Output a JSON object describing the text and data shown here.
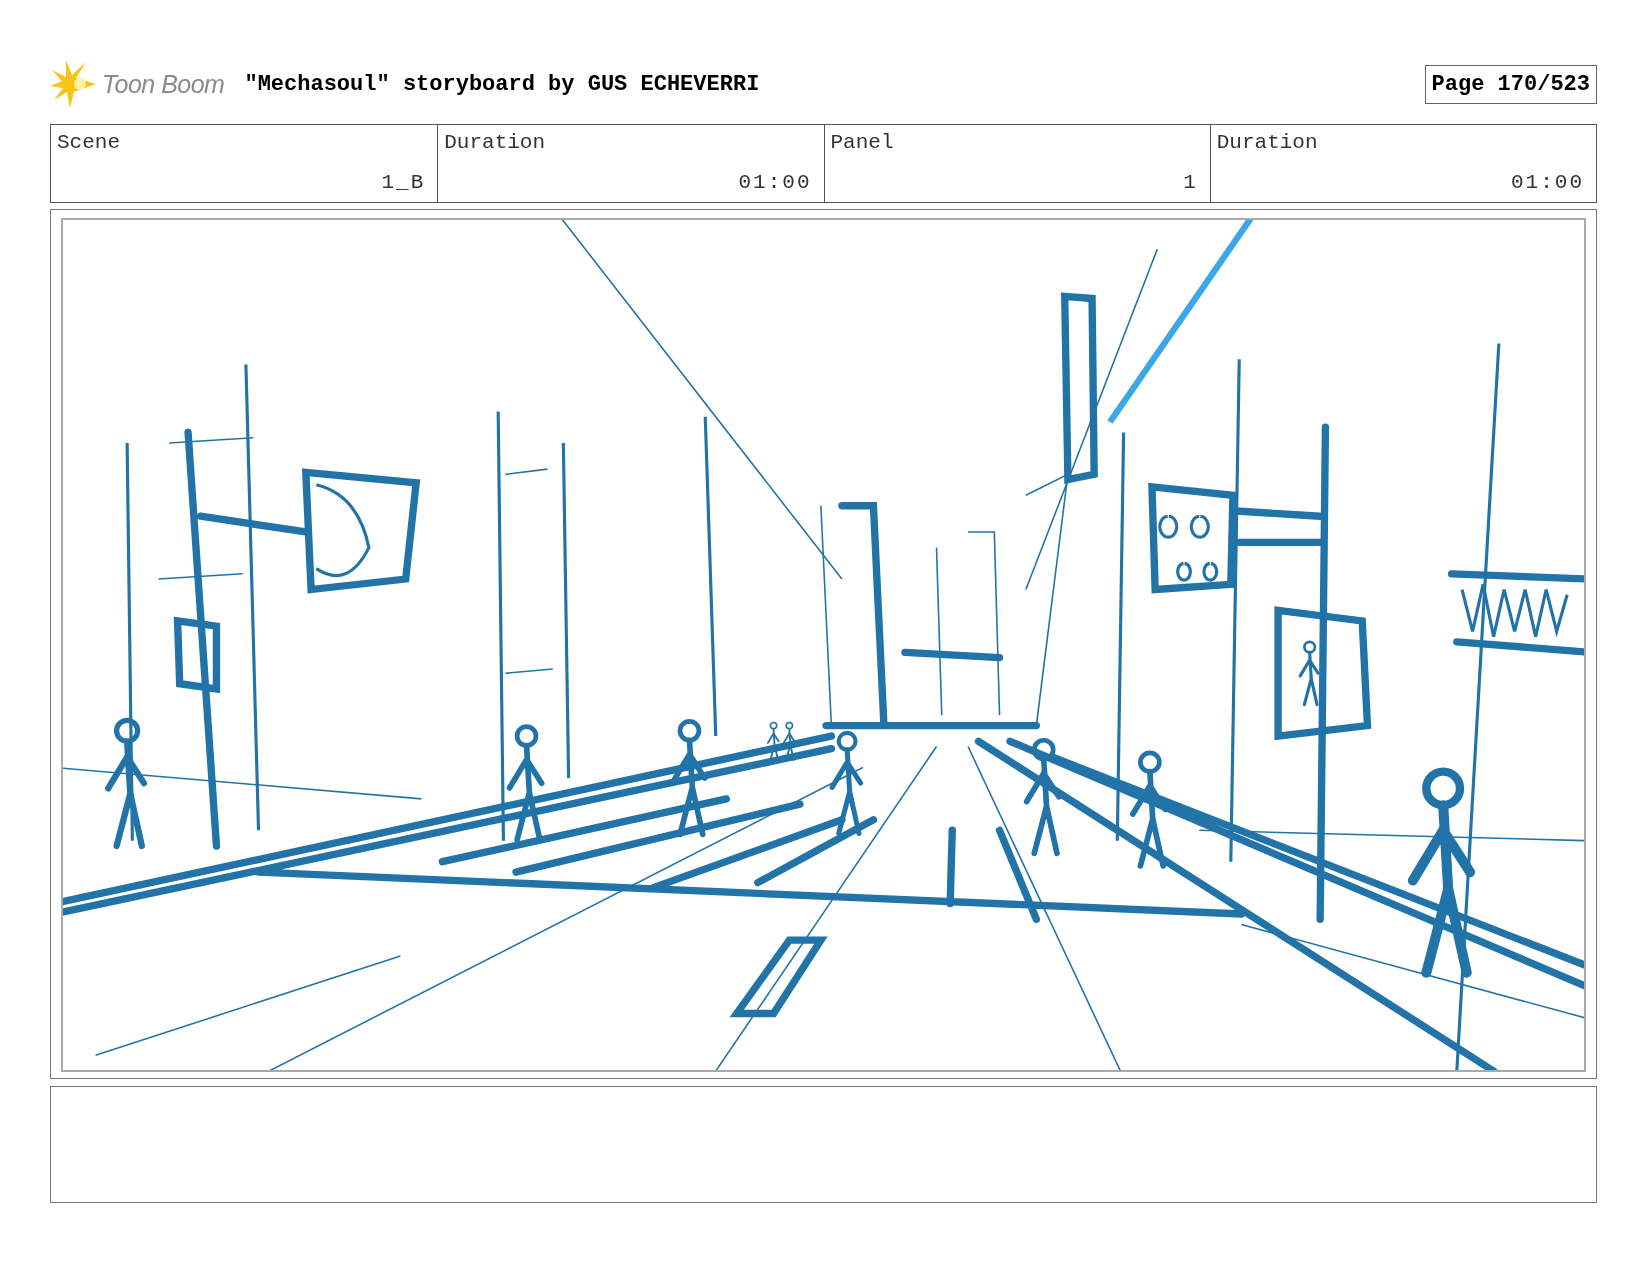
{
  "header": {
    "logo_text": "Toon Boom",
    "title": "\"Mechasoul\" storyboard by GUS ECHEVERRI",
    "page": "Page 170/523"
  },
  "info": [
    {
      "label": "Scene",
      "value": "1_B"
    },
    {
      "label": "Duration",
      "value": "01:00"
    },
    {
      "label": "Panel",
      "value": "1"
    },
    {
      "label": "Duration",
      "value": "01:00"
    }
  ]
}
